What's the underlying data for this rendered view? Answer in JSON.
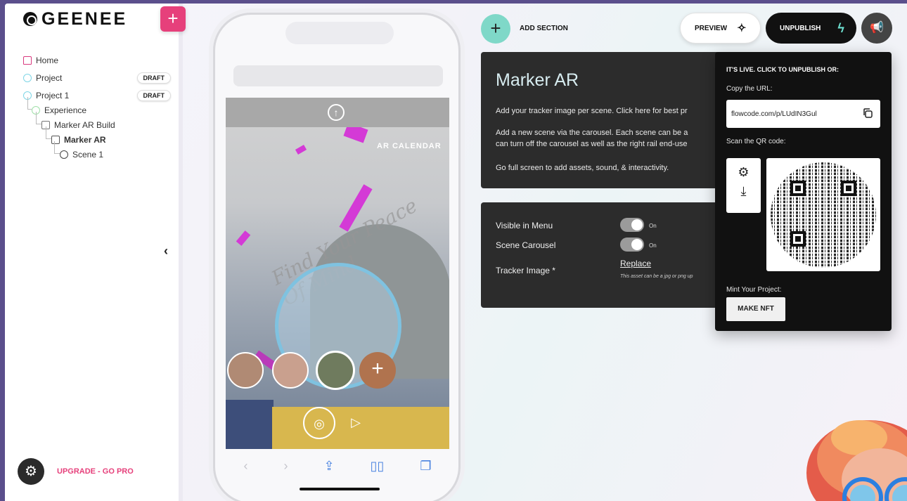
{
  "sidebar": {
    "logo": "GEENEE",
    "add_label": "+",
    "tree": [
      {
        "label": "Home",
        "badge": ""
      },
      {
        "label": "Project",
        "badge": "DRAFT"
      },
      {
        "label": "Project 1",
        "badge": "DRAFT"
      },
      {
        "label": "Experience",
        "badge": ""
      },
      {
        "label": "Marker AR Build",
        "badge": ""
      },
      {
        "label": "Marker AR",
        "badge": ""
      },
      {
        "label": "Scene 1",
        "badge": ""
      }
    ],
    "collapse": "‹",
    "upgrade": "UPGRADE - GO PRO"
  },
  "phone": {
    "overlay_text": "AR CALENDAR",
    "script_text": "Find Your Peace Of Mind"
  },
  "toolbar": {
    "add_section": "ADD SECTION",
    "preview": "PREVIEW",
    "unpublish": "UNPUBLISH"
  },
  "info": {
    "title": "Marker AR",
    "p1": "Add your tracker image per scene. Click here for best pr",
    "p2a": "Add a new scene via the carousel. Each scene can be a",
    "p2b": "can turn off the carousel as well as the right rail end-use",
    "p3": "Go full screen to add assets, sound, & interactivity."
  },
  "settings": {
    "visible_label": "Visible in Menu",
    "visible_state": "On",
    "carousel_label": "Scene Carousel",
    "carousel_state": "On",
    "tracker_label": "Tracker Image *",
    "replace": "Replace",
    "asset_note": "This asset can be a jpg or png up"
  },
  "publish": {
    "heading": "IT'S LIVE. CLICK TO UNPUBLISH OR:",
    "copy_label": "Copy the URL:",
    "url": "flowcode.com/p/LUdIN3Gul",
    "scan_label": "Scan the QR code:",
    "mint_label": "Mint Your Project:",
    "make_nft": "MAKE NFT"
  },
  "colors": {
    "brand_pink": "#e6407b",
    "accent_teal": "#7fd8c8",
    "card_dark": "#2c2c2c",
    "popover_black": "#111111"
  },
  "icons": {
    "add": "plus-icon",
    "preview": "sparkle-icon",
    "unpublish": "bolt-icon",
    "megaphone": "megaphone-icon",
    "copy": "copy-icon",
    "gear": "gear-icon",
    "download": "download-icon"
  }
}
